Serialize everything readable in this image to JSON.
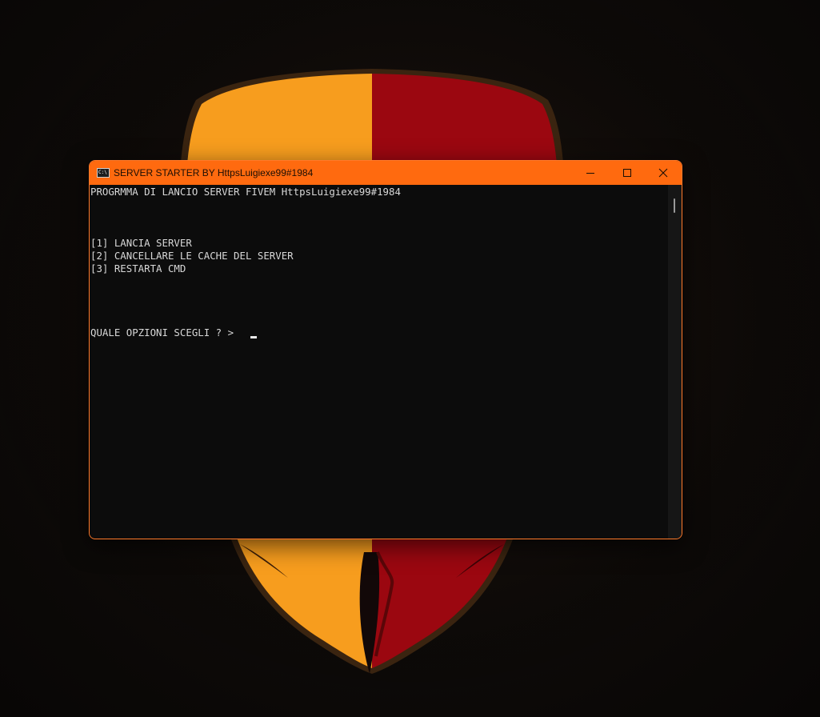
{
  "window": {
    "title": "SERVER STARTER BY HttpsLuigiexe99#1984",
    "icon": "cmd-icon",
    "icon_text": "C:\\",
    "controls": [
      "minimize-icon",
      "maximize-icon",
      "close-icon"
    ]
  },
  "console": {
    "header": "PROGRMMA DI LANCIO SERVER FIVEM HttpsLuigiexe99#1984",
    "options": [
      "[1] LANCIA SERVER",
      "[2] CANCELLARE LE CACHE DEL SERVER",
      "[3] RESTARTA CMD"
    ],
    "prompt": "QUALE OPZIONI SCEGLI ? >"
  },
  "colors": {
    "titlebar": "#ff6a0f",
    "console_bg": "#0c0c0c",
    "console_text": "#d8d8d8",
    "wallpaper_orange": "#f79d1e",
    "wallpaper_red": "#9b0710"
  }
}
